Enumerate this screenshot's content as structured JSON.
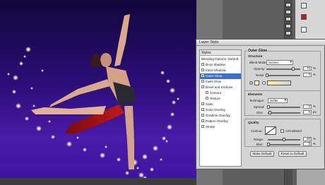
{
  "dialog": {
    "title": "Layer Style",
    "styles_header": "Styles",
    "style_items": [
      {
        "label": "Blending Options: Default",
        "checkbox": false,
        "selected": false
      },
      {
        "label": "Drop Shadow",
        "checkbox": true,
        "selected": false
      },
      {
        "label": "Inner Shadow",
        "checkbox": true,
        "selected": false
      },
      {
        "label": "Outer Glow",
        "checkbox": true,
        "selected": true
      },
      {
        "label": "Inner Glow",
        "checkbox": true,
        "selected": false
      },
      {
        "label": "Bevel and Emboss",
        "checkbox": true,
        "selected": false
      },
      {
        "label": "Contour",
        "checkbox": true,
        "selected": false,
        "sub": true
      },
      {
        "label": "Texture",
        "checkbox": true,
        "selected": false,
        "sub": true
      },
      {
        "label": "Satin",
        "checkbox": true,
        "selected": false
      },
      {
        "label": "Color Overlay",
        "checkbox": true,
        "selected": false
      },
      {
        "label": "Gradient Overlay",
        "checkbox": true,
        "selected": false
      },
      {
        "label": "Pattern Overlay",
        "checkbox": true,
        "selected": false
      },
      {
        "label": "Stroke",
        "checkbox": true,
        "selected": false
      }
    ],
    "outer_glow": {
      "group_title": "Outer Glow",
      "structure_label": "Structure",
      "blend_mode_label": "Blend Mode:",
      "blend_mode_value": "Screen",
      "opacity_label": "Opacity:",
      "opacity_value": "75",
      "noise_label": "Noise:",
      "noise_value": "0",
      "percent": "%",
      "elements_label": "Elements",
      "technique_label": "Technique:",
      "technique_value": "Softer",
      "spread_label": "Spread:",
      "spread_value": "0",
      "size_label": "Size:",
      "size_value": "5",
      "px": "px",
      "quality_label": "Quality",
      "contour_label": "Contour:",
      "anti_aliased_label": "Anti-aliased",
      "range_label": "Range:",
      "range_value": "50",
      "jitter_label": "Jitter:",
      "jitter_value": "0",
      "make_default_label": "Make Default",
      "reset_default_label": "Reset to Default"
    }
  },
  "colors": {
    "selection": "#3a6fd4",
    "glow_color": "#fff8c8"
  }
}
